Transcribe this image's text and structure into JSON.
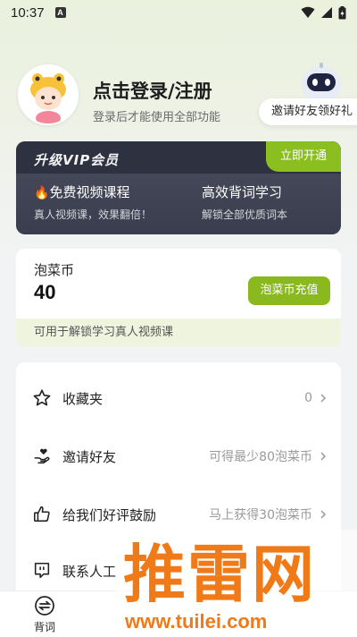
{
  "status_bar": {
    "time": "10:37",
    "notification_badge": "A"
  },
  "profile": {
    "title": "点击登录/注册",
    "subtitle": "登录后才能使用全部功能",
    "invite_badge": "邀请好友领好礼"
  },
  "vip": {
    "title": "升级VIP会员",
    "open_button": "立即开通",
    "features": [
      {
        "title": "免费视频课程",
        "sub": "真人视频课，效果翻倍！"
      },
      {
        "title": "高效背词学习",
        "sub": "解锁全部优质词本"
      }
    ]
  },
  "coins": {
    "label": "泡菜币",
    "value": "40",
    "recharge_button": "泡菜币充值",
    "footer": "可用于解锁学习真人视频课"
  },
  "menu": {
    "items": [
      {
        "label": "收藏夹",
        "value": "0",
        "icon": "star-icon"
      },
      {
        "label": "邀请好友",
        "value": "可得最少80泡菜币",
        "icon": "hand-heart-icon"
      },
      {
        "label": "给我们好评鼓励",
        "value": "马上获得30泡菜币",
        "icon": "thumbs-up-icon"
      },
      {
        "label": "联系人工",
        "value": "",
        "icon": "chat-bubble-icon"
      }
    ]
  },
  "bottom_nav": {
    "tabs": [
      {
        "label": "背词",
        "icon": "swap-icon"
      }
    ]
  },
  "watermark": {
    "text": "推雷网",
    "url": "www.tuilei.com"
  },
  "colors": {
    "accent": "#8bbf1f",
    "vip_bg": "#3f4253",
    "coin_footer_bg": "#eef4de"
  }
}
